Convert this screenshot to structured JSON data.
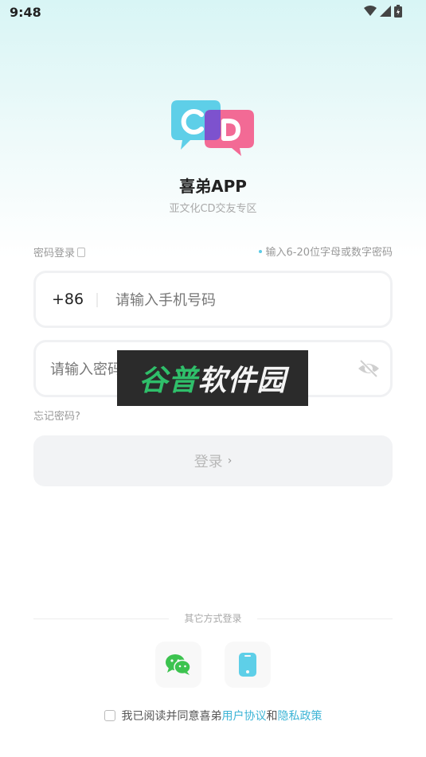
{
  "status_bar": {
    "time": "9:48",
    "icons": [
      "wifi-icon",
      "signal-icon",
      "battery-icon"
    ]
  },
  "app": {
    "logo_text": "CD",
    "name": "喜弟APP",
    "slogan": "亚文化CD交友专区"
  },
  "login_form": {
    "mode_label": "密码登录",
    "password_hint": "输入6-20位字母或数字密码",
    "country_code": "+86",
    "phone_placeholder": "请输入手机号码",
    "password_placeholder": "请输入密码",
    "forgot_password": "忘记密码?",
    "login_button": "登录",
    "login_arrow": "›"
  },
  "watermark": {
    "part1": "谷普",
    "part2": "软件园"
  },
  "other_login": {
    "title": "其它方式登录",
    "options": [
      "wechat-icon",
      "phone-icon"
    ]
  },
  "agreement": {
    "prefix": "我已阅读并同意喜弟",
    "user_agreement": "用户协议",
    "and": "和",
    "privacy_policy": "隐私政策"
  },
  "colors": {
    "accent": "#3db4d6",
    "logo_cyan": "#5ecfe8",
    "logo_pink": "#f2628f",
    "wechat_green": "#3cc34f"
  }
}
